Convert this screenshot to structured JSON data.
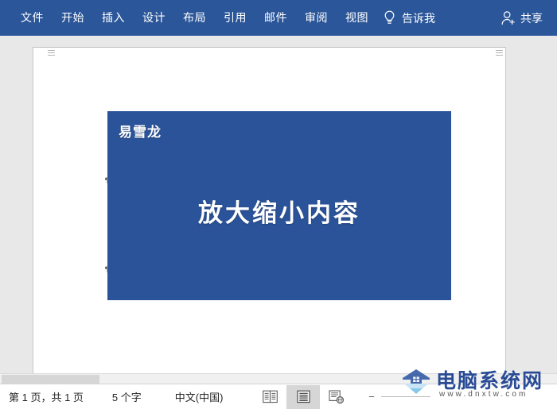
{
  "app": {
    "name": "Microsoft Word",
    "ribbon_color": "#2b579a",
    "picture_color": "#2b5399"
  },
  "ribbon": {
    "tabs": [
      {
        "label": "文件",
        "name": "tab-file"
      },
      {
        "label": "开始",
        "name": "tab-home"
      },
      {
        "label": "插入",
        "name": "tab-insert"
      },
      {
        "label": "设计",
        "name": "tab-design"
      },
      {
        "label": "布局",
        "name": "tab-layout"
      },
      {
        "label": "引用",
        "name": "tab-references"
      },
      {
        "label": "邮件",
        "name": "tab-mailings"
      },
      {
        "label": "审阅",
        "name": "tab-review"
      },
      {
        "label": "视图",
        "name": "tab-view"
      }
    ],
    "tell_me": {
      "label": "告诉我",
      "icon": "lightbulb-icon"
    },
    "share": {
      "label": "共享",
      "icon": "person-add-icon"
    }
  },
  "document": {
    "picture": {
      "watermark_text": "易雪龙",
      "title_text": "放大缩小内容"
    },
    "paragraph_marks": [
      "¶",
      "¶"
    ]
  },
  "status_bar": {
    "page_info": "第 1 页，共 1 页",
    "word_count": "5 个字",
    "language": "中文(中国)",
    "views": [
      {
        "name": "view-read-mode",
        "title": "阅读视图",
        "active": false
      },
      {
        "name": "view-print-layout",
        "title": "页面视图",
        "active": true
      },
      {
        "name": "view-web-layout",
        "title": "Web 版式视图",
        "active": false
      }
    ],
    "zoom": {
      "minus_label": "−"
    }
  },
  "watermark": {
    "site_name": "电脑系统网",
    "site_url": "www.dnxtw.com"
  }
}
